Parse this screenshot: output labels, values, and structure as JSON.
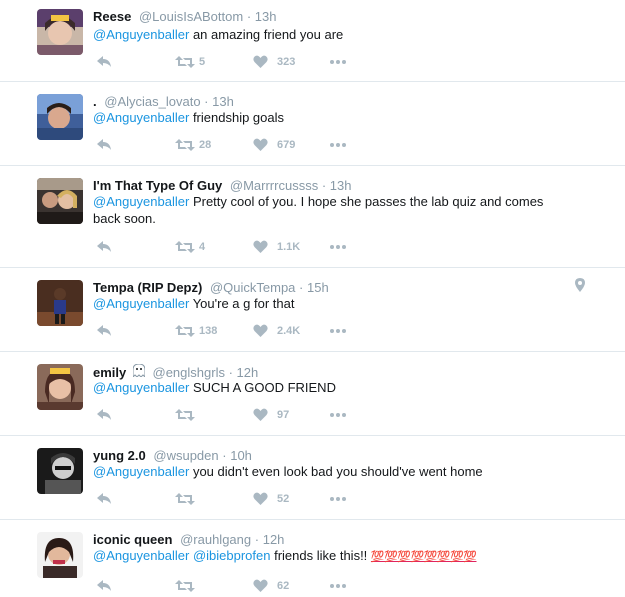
{
  "tweets": [
    {
      "name": "Reese",
      "handle": "@LouisIsABottom",
      "time": "13h",
      "mention": "@Anguyenballer",
      "text": " an amazing friend you are",
      "retweets": "5",
      "likes": "323",
      "avatar_color": "#6b4b7b"
    },
    {
      "name": ".",
      "handle": "@Alycias_lovato",
      "time": "13h",
      "mention": "@Anguyenballer",
      "text": " friendship goals",
      "retweets": "28",
      "likes": "679",
      "avatar_color": "#4a5fa0"
    },
    {
      "name": "I'm That Type Of Guy",
      "handle": "@Marrrrcussss",
      "time": "13h",
      "mention": "@Anguyenballer",
      "text": " Pretty cool of you. I hope she passes the lab quiz and comes back soon.",
      "retweets": "4",
      "likes": "1.1K",
      "avatar_color": "#5a4a3c"
    },
    {
      "name": "Tempa (RIP Depz)",
      "handle": "@QuickTempa",
      "time": "15h",
      "mention": "@Anguyenballer",
      "text": " You're a g for that",
      "retweets": "138",
      "likes": "2.4K",
      "avatar_color": "#3b2a22"
    },
    {
      "name": "emily",
      "handle": "@englshgrls",
      "time": "12h",
      "mention": "@Anguyenballer",
      "text": " SUCH A GOOD FRIEND",
      "retweets": "",
      "likes": "97",
      "avatar_color": "#7a3e3a"
    },
    {
      "name": "yung 2.0",
      "handle": "@wsupden",
      "time": "10h",
      "mention": "@Anguyenballer",
      "text": " you didn't even look bad you should've went home",
      "retweets": "",
      "likes": "52",
      "avatar_color": "#2b2b2b"
    },
    {
      "name": "iconic queen",
      "handle": "@rauhlgang",
      "time": "12h",
      "mention": "@Anguyenballer",
      "mention2": "@ibiebprofen",
      "text": " friends like this!! ",
      "emoji": "💯💯💯💯💯💯💯💯",
      "retweets": "",
      "likes": "62",
      "avatar_color": "#3e2c2a"
    }
  ],
  "separator": "·",
  "colors": {
    "link": "#1b95e0",
    "muted": "#8899a6",
    "icon": "#aab8c2",
    "border": "#e1e8ed"
  }
}
